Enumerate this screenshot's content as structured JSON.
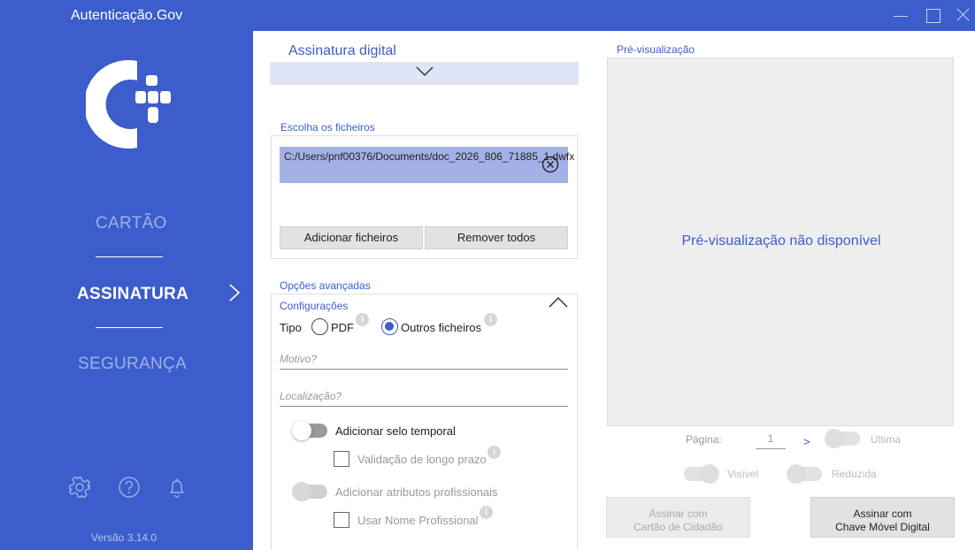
{
  "window": {
    "title": "Autenticação.Gov"
  },
  "sidebar": {
    "items": [
      {
        "label": "CARTÃO"
      },
      {
        "label": "ASSINATURA"
      },
      {
        "label": "SEGURANÇA"
      }
    ],
    "version": "Versão 3.14.0",
    "colors": {
      "background": "#3c5dcb",
      "active": "#ffffff",
      "inactive": "#9eb0e8"
    }
  },
  "signature": {
    "header": "Assinatura digital"
  },
  "files": {
    "label": "Escolha os ficheiros",
    "items": [
      "C:/Users/pnf00376/Documents/doc_2026_806_71885_1.dwfx"
    ],
    "add_button": "Adicionar ficheiros",
    "remove_all_button": "Remover todos"
  },
  "advanced": {
    "label": "Opções avançadas",
    "config_label": "Configurações",
    "tipo_label": "Tipo",
    "tipo_options": [
      {
        "label": "PDF",
        "selected": false
      },
      {
        "label": "Outros ficheiros",
        "selected": true
      }
    ],
    "motivo_placeholder": "Motivo?",
    "local_placeholder": "Localização?",
    "selo_label": "Adicionar selo temporal",
    "validacao_label": "Validação de longo prazo",
    "atributos_label": "Adicionar atributos profissionais",
    "usar_nome_label": "Usar Nome Profissional"
  },
  "preview": {
    "label": "Pré-visualização",
    "empty_text": "Pré-visualização não disponível",
    "page_label": "Página:",
    "page_value": "1",
    "next_symbol": ">",
    "last_label": "Última",
    "visible_label": "Visível",
    "reduced_label": "Reduzida"
  },
  "actions": {
    "sign_card_line1": "Assinar com",
    "sign_card_line2": "Cartão de Cidadão",
    "sign_key_line1": "Assinar com",
    "sign_key_line2": "Chave Móvel Digital"
  },
  "icons": {
    "logo": "autenticacao-gov-logo",
    "settings": "gear-icon",
    "help": "help-icon",
    "notifications": "bell-icon",
    "info": "info-icon",
    "remove_file": "close-circle-icon"
  }
}
